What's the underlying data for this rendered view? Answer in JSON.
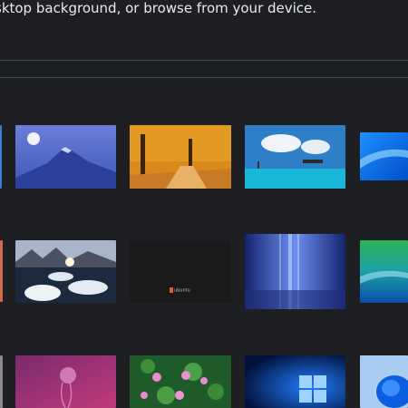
{
  "header": {
    "hint_text": "sktop background, or browse from your device."
  },
  "wallpapers": [
    {
      "name": "mountain-moon",
      "icon": "wallpaper-thumbnail"
    },
    {
      "name": "autumn-trees",
      "icon": "wallpaper-thumbnail"
    },
    {
      "name": "tropical-sea",
      "icon": "wallpaper-thumbnail"
    },
    {
      "name": "blue-abstract",
      "icon": "wallpaper-thumbnail"
    },
    {
      "name": "icebergs",
      "icon": "wallpaper-thumbnail"
    },
    {
      "name": "ubuntu-dark",
      "icon": "wallpaper-thumbnail",
      "brand_text": "ubuntu"
    },
    {
      "name": "blue-light-rays",
      "icon": "wallpaper-thumbnail"
    },
    {
      "name": "vista-green-blue",
      "icon": "wallpaper-thumbnail"
    },
    {
      "name": "purple-jellyfish",
      "icon": "wallpaper-thumbnail"
    },
    {
      "name": "water-lilies",
      "icon": "wallpaper-thumbnail"
    },
    {
      "name": "windows-logo",
      "icon": "wallpaper-thumbnail"
    },
    {
      "name": "blue-flower",
      "icon": "wallpaper-thumbnail"
    }
  ],
  "colors": {
    "background": "#1e1f22",
    "text": "#e8eaed",
    "divider": "#43464b"
  }
}
